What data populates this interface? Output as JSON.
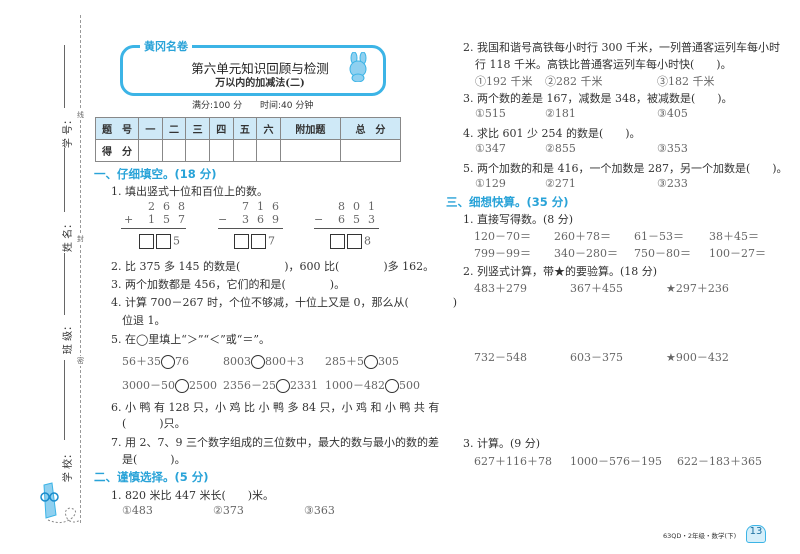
{
  "side": {
    "student_no": "学 号：",
    "name": "姓 名：",
    "class": "班 级：",
    "school": "学 校：",
    "seal_1": "线",
    "seal_2": "封",
    "seal_3": "密"
  },
  "header": {
    "logo": "黄冈名卷",
    "title": "第六单元知识回顾与检测",
    "subtitle": "万以内的加减法(二)",
    "full_score": "满分:100 分",
    "time": "时间:40 分钟"
  },
  "score_table": {
    "headers": [
      "题　号",
      "一",
      "二",
      "三",
      "四",
      "五",
      "六",
      "附加题",
      "总　分"
    ],
    "row_label": "得　分"
  },
  "sec1": {
    "title": "一、仔细填空。(18 分)",
    "q1": "1. 填出竖式十位和百位上的数。",
    "sums": [
      {
        "top": "268",
        "op": "+",
        "bottom": "157",
        "last": "5"
      },
      {
        "top": "716",
        "op": "−",
        "bottom": "369",
        "last": "7"
      },
      {
        "top": "801",
        "op": "−",
        "bottom": "653",
        "last": "8"
      }
    ],
    "q2": "2. 比 375 多 145 的数是(　　　　)，600 比(　　　　)多 162。",
    "q3": "3. 两个加数都是 456，它们的和是(　　　　)。",
    "q4a": "4. 计算 700－267 时，个位不够减，十位上又是 0，那么从(　　　　)",
    "q4b": "位退 1。",
    "q5": "5. 在◯里填上“＞”“＜”或“＝”。",
    "compare": [
      [
        "56＋35",
        "76"
      ],
      [
        "8003",
        "800＋3"
      ],
      [
        "285＋5",
        "305"
      ],
      [
        "3000－50",
        "2500"
      ],
      [
        "2356－25",
        "2331"
      ],
      [
        "1000－482",
        "500"
      ]
    ],
    "q6a": "6. 小 鸭 有 128 只，小 鸡 比 小 鸭 多 84 只，小 鸡 和 小 鸭 共 有",
    "q6b": "(　　　)只。",
    "q7a": "7. 用 2、7、9 三个数字组成的三位数中，最大的数与最小的数的差",
    "q7b": "是(　　　)。"
  },
  "sec2": {
    "title": "二、谨慎选择。(5 分)",
    "questions": [
      {
        "text": "1. 820 米比 447 米长(　　)米。",
        "options": [
          "①483",
          "②373",
          "③363"
        ]
      },
      {
        "text": "2. 我国和谐号高铁每小时行 300 千米，一列普通客运列车每小时",
        "text2": "行 118 千米。高铁比普通客运列车每小时快(　　)。",
        "options": [
          "①192 千米",
          "②282 千米",
          "③182 千米"
        ]
      },
      {
        "text": "3. 两个数的差是 167，减数是 348，被减数是(　　)。",
        "options": [
          "①515",
          "②181",
          "③405"
        ]
      },
      {
        "text": "4. 求比 601 少 254 的数是(　　)。",
        "options": [
          "①347",
          "②855",
          "③353"
        ]
      },
      {
        "text": "5. 两个加数的和是 416，一个加数是 287，另一个加数是(　　)。",
        "options": [
          "①129",
          "②271",
          "③233"
        ]
      }
    ]
  },
  "sec3": {
    "title": "三、细想快算。(35 分)",
    "q1": "1. 直接写得数。(8 分)",
    "oral": [
      "120－70＝",
      "260＋78＝",
      "61－53＝",
      "38＋45＝",
      "799－99＝",
      "340－280＝",
      "750－80＝",
      "100－27＝"
    ],
    "q2": "2. 列竖式计算，带★的要验算。(18 分)",
    "vertical": [
      "483＋279",
      "367＋455",
      "★297＋236",
      "732－548",
      "603－375",
      "★900－432"
    ],
    "q3": "3. 计算。(9 分)",
    "calc": [
      "627＋116＋78",
      "1000－576－195",
      "622－183＋365"
    ]
  },
  "footer": {
    "text": "63QD・2年级・数学(下)",
    "page": "13"
  }
}
